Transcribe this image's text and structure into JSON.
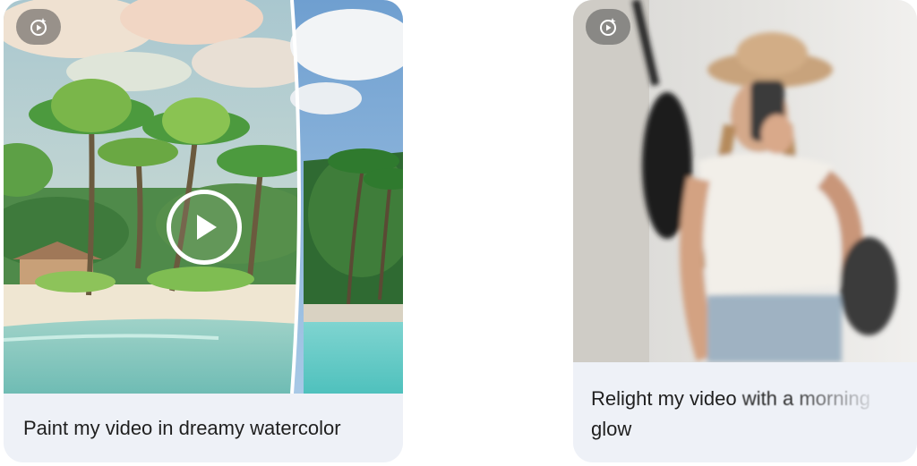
{
  "cards": [
    {
      "caption": "Paint my video in dreamy watercolor",
      "icon": "video-magic-icon",
      "play_icon": "play-icon"
    },
    {
      "caption_line1_clear": "Relight my video",
      "caption_line1_faded": "with a morning",
      "caption_line2": "glow",
      "icon": "video-magic-icon"
    }
  ]
}
